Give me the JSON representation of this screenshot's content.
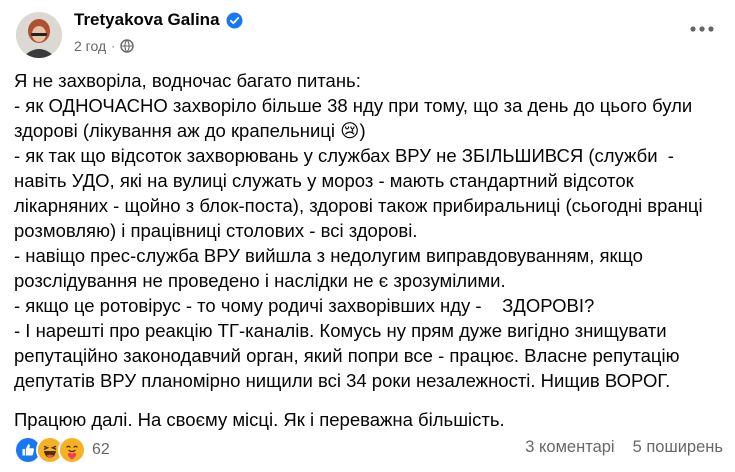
{
  "post": {
    "author": "Tretyakova Galina",
    "time": "2 год",
    "separator": "·",
    "verified_icon": "verified-badge-icon",
    "privacy_icon": "globe-icon",
    "more_icon": "more-horizontal-icon",
    "lines": [
      "Я не захворіла, водночас багато питань:",
      "- як ОДНОЧАСНО захворіло більше 38 нду при тому, що за день до цього були",
      "здорові (лікування аж до крапельниці 😢)",
      "- як так що відсоток захворювань у службах ВРУ не ЗБІЛЬШИВСЯ (служби  -",
      "навіть УДО, які на вулиці служать у мороз - мають стандартний відсоток",
      "лікарняних - щойно з блок-поста), здорові також прибиральниці (сьогодні вранці",
      "розмовляю) і працівниці столових - всі здорові.",
      "- навіщо прес-служба ВРУ вийшла з недолугим виправдовуванням, якщо",
      "розслідування не проведено і наслідки не є зрозумілими.",
      "- якщо це ротовірус - то чому родичі захворівших нду -    ЗДОРОВІ?",
      "- І нарешті про реакцію ТГ-каналів. Комусь ну прям дуже вигідно знищувати",
      "репутаційно законодавчий орган, який попри все - працює. Власне репутацію",
      "депутатів ВРУ планомірно нищили всі 34 роки незалежності. Нищив ВОРОГ."
    ],
    "closing_line": "Працюю далі. На своєму місці. Як і переважна більшість.",
    "reactions": {
      "icons": [
        "like-icon",
        "haha-icon",
        "care-icon"
      ],
      "count": "62"
    },
    "comments": "3 коментарі",
    "shares": "5 поширень",
    "colors": {
      "like": "#1877f2",
      "haha": "#f7b125",
      "care": "#f7b125",
      "secondary_text": "#65676b"
    }
  }
}
